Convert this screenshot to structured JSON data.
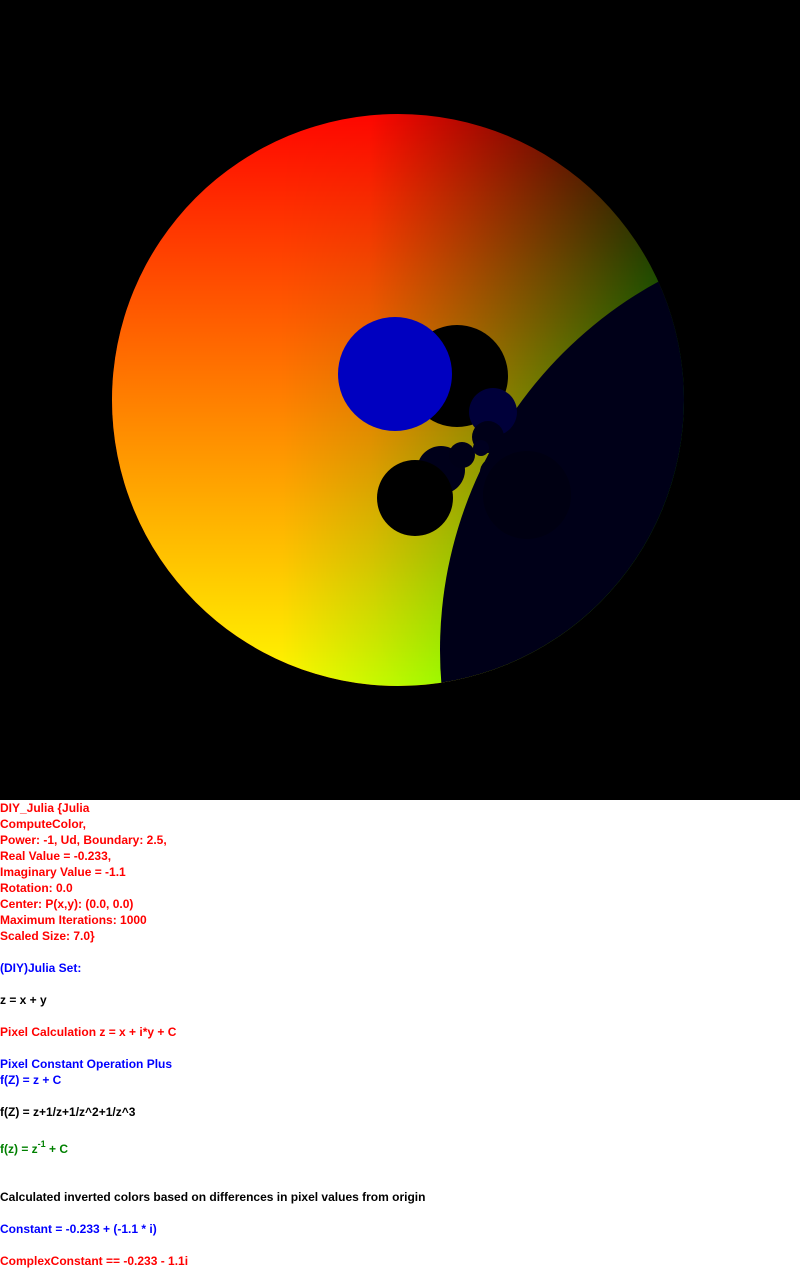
{
  "colors": {
    "background": "#000000",
    "red": "#ff0000",
    "yellow": "#ffff00",
    "green": "#00ff00",
    "blue": "#0000c0",
    "dark_navy": "#000018",
    "text_red": "#ff0000",
    "text_blue": "#0000ff",
    "text_black": "#000000",
    "text_green": "#008000"
  },
  "info": {
    "title": "DIY_Julia {Julia",
    "compute": "ComputeColor,",
    "power": "Power: -1, Ud, Boundary: 2.5,",
    "real": "Real Value = -0.233,",
    "imag": "Imaginary Value = -1.1",
    "rotation": "Rotation: 0.0",
    "center": "Center: P(x,y): (0.0, 0.0)",
    "max_iter": "Maximum Iterations: 1000",
    "scaled": "Scaled Size: 7.0}",
    "set_name": "(DIY)Julia Set:",
    "z_def": "z = x + y",
    "pixel_calc": "Pixel Calculation z = x + i*y + C",
    "op": "Pixel Constant Operation Plus",
    "fz1": "f(Z) = z + C",
    "fz2": "f(Z) = z+1/z+1/z^2+1/z^3",
    "fz3_base": "f(z) = z",
    "fz3_exp": "-1",
    "fz3_tail": " + C",
    "inverted": "Calculated inverted colors based on differences in pixel values from origin",
    "constant": "Constant = -0.233 + (-1.1 * i)",
    "complex": "ComplexConstant == -0.233 - 1.1i"
  }
}
